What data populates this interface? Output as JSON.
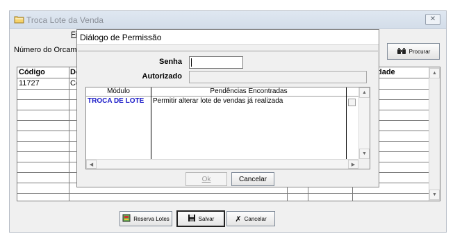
{
  "window": {
    "title": "Troca Lote da Venda",
    "close_glyph": "✕",
    "menu_file": "Fi",
    "budget_label": "Número do Orcamen",
    "search_button": "Procurar"
  },
  "grid": {
    "headers": [
      "Código",
      "De",
      "dade"
    ],
    "rows": [
      {
        "codigo": "11727",
        "desc": "Co"
      }
    ],
    "scroll_up": "▲",
    "scroll_down": "▼"
  },
  "bottom_buttons": {
    "reserva": "Reserva Lotes",
    "salvar": "Salvar",
    "cancelar": "Cancelar"
  },
  "dialog": {
    "title": "Diálogo de Permissão",
    "senha_label": "Senha",
    "autorizado_label": "Autorizado",
    "senha_value": "",
    "autorizado_value": "",
    "list_headers": [
      "Módulo",
      "Pendências Encontradas"
    ],
    "rows": [
      {
        "module": "TROCA DE LOTE",
        "description": "Permitir alterar lote de vendas já realizada"
      }
    ],
    "ok_button": "Ok",
    "cancel_button": "Cancelar",
    "scroll_up": "▲",
    "scroll_down": "▼",
    "scroll_left": "◀",
    "scroll_right": "▶"
  },
  "icons": {
    "window_icon": "folder-icon",
    "search_icon": "binoculars-icon",
    "reserva_icon": "reserve-icon",
    "salvar_icon": "floppy-disk-icon",
    "cancelar_icon": "cancel-x-icon"
  },
  "colors": {
    "module_text": "#1a1ac8",
    "titlebar": "#dfe7f1"
  }
}
